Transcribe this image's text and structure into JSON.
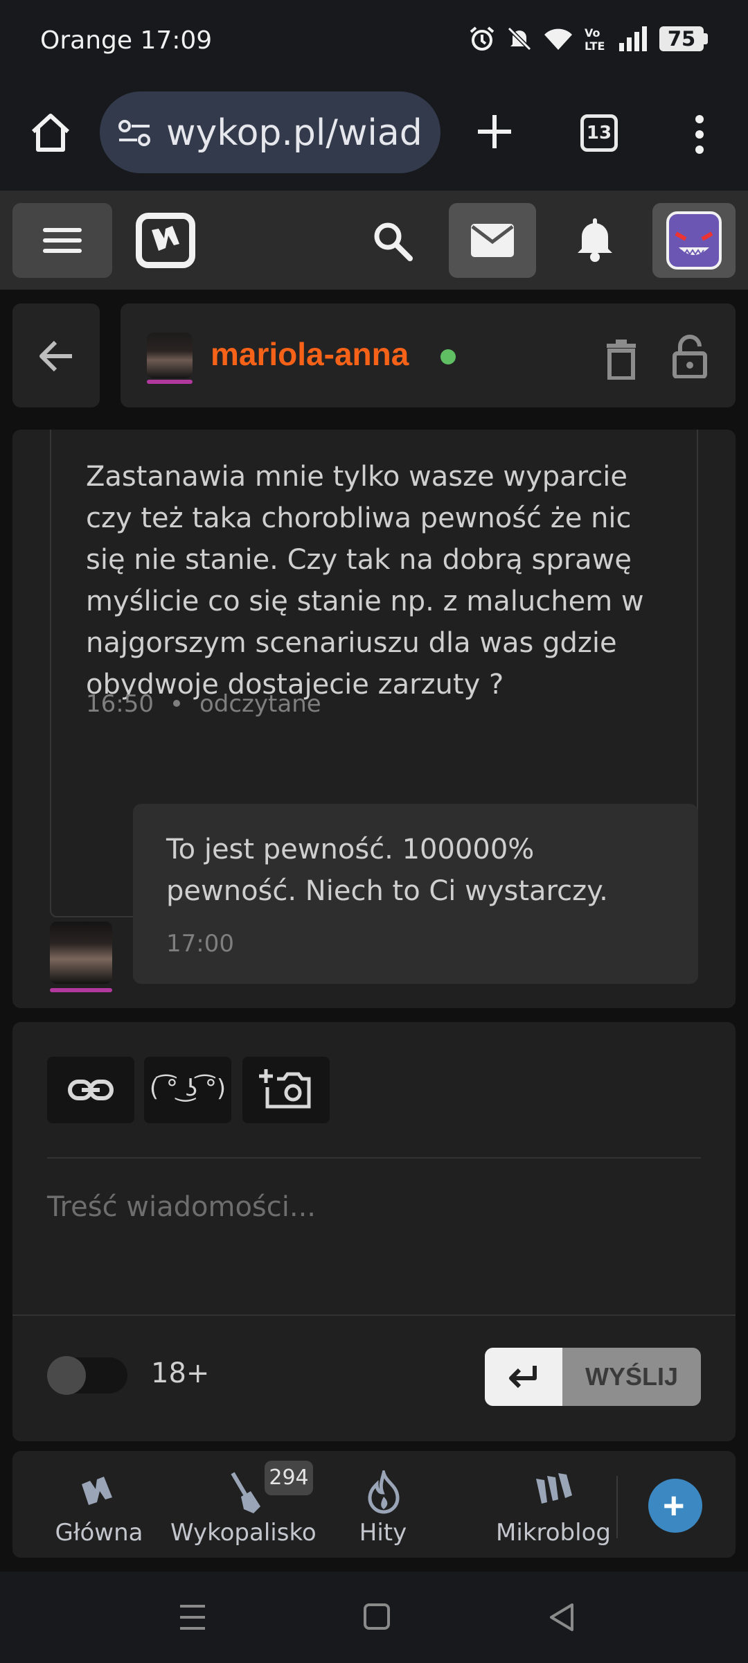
{
  "status_bar": {
    "carrier_time": "Orange 17:09",
    "battery": "75",
    "icons": [
      "alarm-icon",
      "bell-muted-icon",
      "wifi-icon",
      "volte-icon",
      "signal-icon",
      "battery-icon"
    ]
  },
  "browser": {
    "url": "wykop.pl/wiadomosci",
    "tab_count": "13"
  },
  "conversation": {
    "username": "mariola-anna",
    "online": true,
    "messages": [
      {
        "direction": "outgoing",
        "text": "Zastanawia mnie tylko wasze wyparcie czy też taka chorobliwa pewność że nic się nie stanie. Czy tak na dobrą sprawę myślicie co się stanie np. z maluchem w najgorszym scenariuszu dla was gdzie obydwoje dostajecie zarzuty ?",
        "time": "16:50",
        "status": "odczytane"
      },
      {
        "direction": "incoming",
        "text": "To jest pewność. 100000% pewność. Niech to Ci wystarczy.",
        "time": "17:00"
      }
    ]
  },
  "composer": {
    "lenny": "( ͡° ͜ʖ ͡°)",
    "placeholder": "Treść wiadomości...",
    "adult_label": "18+",
    "send_label": "WYŚLIJ"
  },
  "bottom_nav": {
    "items": [
      {
        "label": "Główna"
      },
      {
        "label": "Wykopalisko",
        "badge": "294"
      },
      {
        "label": "Hity"
      },
      {
        "label": "Mikroblog"
      }
    ],
    "fab": "+"
  },
  "colors": {
    "username": "#f56218",
    "online": "#5fbf62",
    "avatar_underline": "#b1399e",
    "fab": "#3b88c3"
  }
}
